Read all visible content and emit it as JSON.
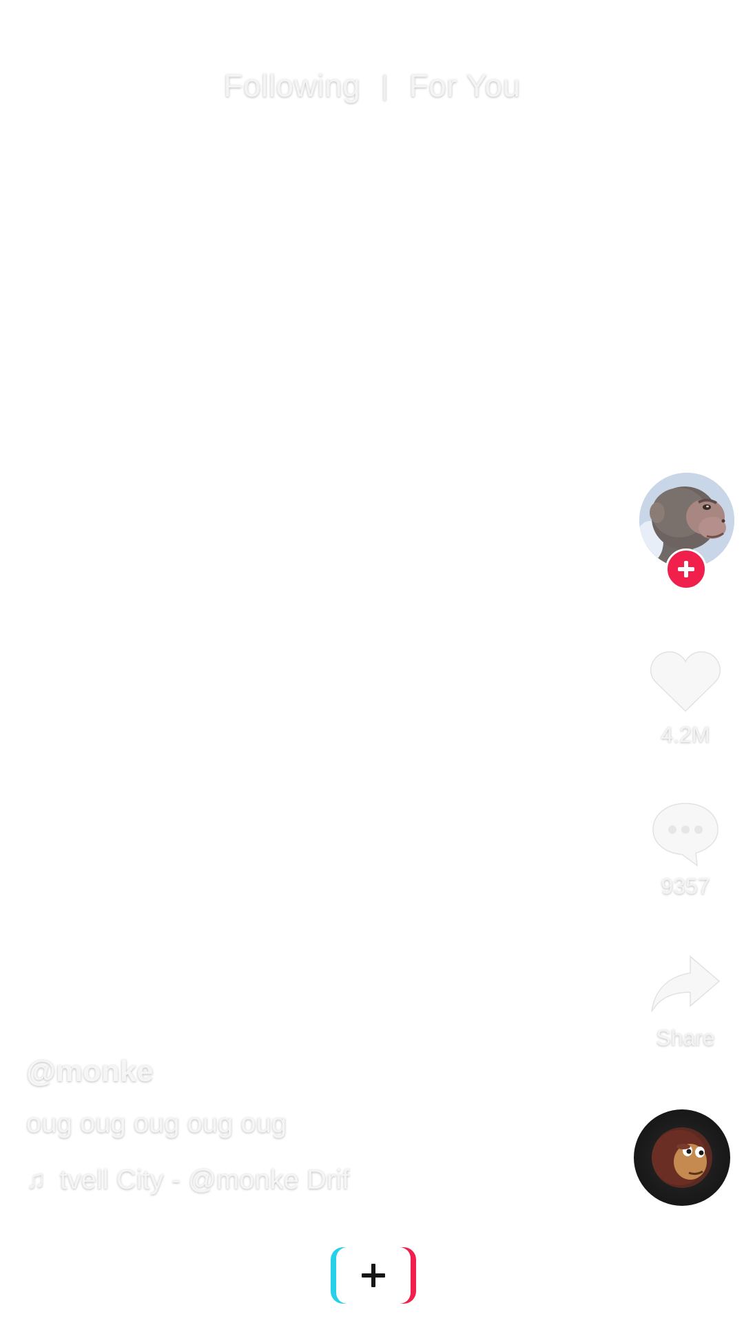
{
  "top_tabs": {
    "following_label": "Following",
    "divider": "|",
    "for_you_label": "For You"
  },
  "actions": {
    "like_count": "4.2M",
    "comment_count": "9357",
    "share_label": "Share"
  },
  "post": {
    "username": "@monke",
    "caption": "oug oug oug oug oug",
    "music_note": "♫",
    "music_text": "tvell City - @monke  Drif"
  },
  "icons": {
    "avatar": "monkey-avatar-icon",
    "follow": "plus-icon",
    "like": "heart-icon",
    "comment": "comment-bubble-icon",
    "share": "share-arrow-icon",
    "music_disc": "music-disc-icon",
    "create": "plus-icon"
  },
  "colors": {
    "accent_pink": "#f01f4b",
    "accent_cyan": "#25d1e8",
    "overlay_text": "#f5f5f5",
    "disc": "#1a1a1a"
  }
}
